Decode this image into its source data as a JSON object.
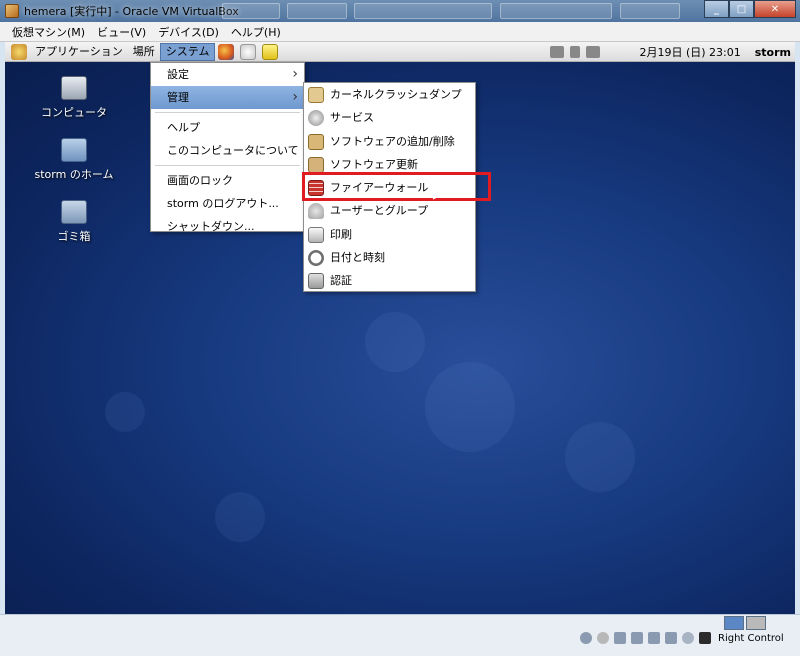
{
  "window": {
    "title": "hemera [実行中] - Oracle VM VirtualBox"
  },
  "vbox_menu": [
    "仮想マシン(M)",
    "ビュー(V)",
    "デバイス(D)",
    "ヘルプ(H)"
  ],
  "panel": {
    "menus": [
      "アプリケーション",
      "場所",
      "システム"
    ],
    "clock": "2月19日 (日) 23:01",
    "user": "storm"
  },
  "desktop_icons": [
    {
      "label": "コンピュータ",
      "icon": "computer-icon"
    },
    {
      "label": "storm のホーム",
      "icon": "home-folder-icon"
    },
    {
      "label": "ゴミ箱",
      "icon": "trash-icon"
    }
  ],
  "system_menu": {
    "items": [
      "設定",
      "管理",
      "ヘルプ",
      "このコンピュータについて",
      "画面のロック",
      "storm のログアウト...",
      "シャットダウン..."
    ]
  },
  "admin_submenu": {
    "items": [
      {
        "label": "カーネルクラッシュダンプ",
        "icon": "kernel-dump-icon"
      },
      {
        "label": "サービス",
        "icon": "services-icon"
      },
      {
        "label": "ソフトウェアの追加/削除",
        "icon": "software-add-remove-icon"
      },
      {
        "label": "ソフトウェア更新",
        "icon": "software-update-icon"
      },
      {
        "label": "ファイアーウォール",
        "icon": "firewall-icon"
      },
      {
        "label": "ユーザーとグループ",
        "icon": "users-groups-icon"
      },
      {
        "label": "印刷",
        "icon": "printer-icon"
      },
      {
        "label": "日付と時刻",
        "icon": "clock-icon"
      },
      {
        "label": "認証",
        "icon": "authentication-icon"
      }
    ]
  },
  "status": {
    "host_key": "Right Control"
  },
  "colors": {
    "highlight": "#e11b22",
    "menu_selection": "#7aa0d2",
    "desktop": "#1a3a80"
  }
}
